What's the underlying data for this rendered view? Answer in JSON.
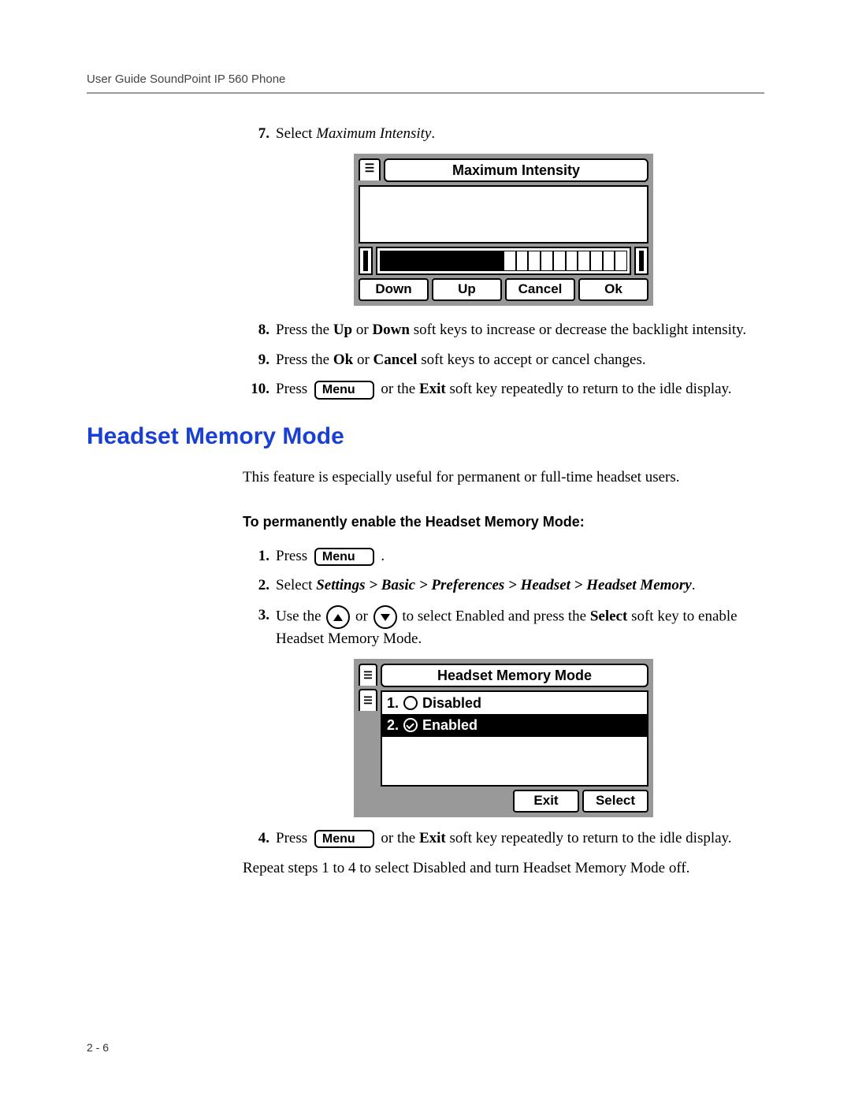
{
  "header": "User Guide SoundPoint IP 560 Phone",
  "page_number": "2 - 6",
  "steps_a": {
    "n7": "7.",
    "s7_a": "Select ",
    "s7_b": "Maximum Intensity",
    "s7_c": ".",
    "n8": "8.",
    "s8_a": "Press the ",
    "s8_b": "Up",
    "s8_c": " or ",
    "s8_d": "Down",
    "s8_e": " soft keys to increase or decrease the backlight intensity.",
    "n9": "9.",
    "s9_a": "Press the ",
    "s9_b": "Ok",
    "s9_c": " or ",
    "s9_d": "Cancel",
    "s9_e": " soft keys to accept or cancel changes.",
    "n10": "10.",
    "s10_a": "Press ",
    "s10_b": " or the ",
    "s10_c": "Exit",
    "s10_d": " soft key repeatedly to return to the idle display."
  },
  "menu_label": "Menu",
  "lcd_max": {
    "title": "Maximum Intensity",
    "softkeys": [
      "Down",
      "Up",
      "Cancel",
      "Ok"
    ],
    "segments_filled": 10,
    "segments_total": 20
  },
  "section_title": "Headset Memory Mode",
  "section_intro": "This feature is especially useful for permanent or full-time headset users.",
  "subhead": "To permanently enable the Headset Memory Mode:",
  "steps_b": {
    "n1": "1.",
    "s1_a": "Press ",
    "s1_b": ".",
    "n2": "2.",
    "s2_a": "Select ",
    "s2_b": "Settings > Basic > Preferences > Headset > Headset Memory",
    "s2_c": ".",
    "n3": "3.",
    "s3_a": "Use the ",
    "s3_b": " or ",
    "s3_c": " to select Enabled and press the ",
    "s3_d": "Select",
    "s3_e": " soft key to enable Headset Memory Mode.",
    "n4": "4.",
    "s4_a": "Press ",
    "s4_b": " or the ",
    "s4_c": "Exit",
    "s4_d": " soft key repeatedly to return to the idle display."
  },
  "lcd_hmm": {
    "title": "Headset Memory Mode",
    "item1_prefix": "1.",
    "item1_label": "Disabled",
    "item2_prefix": "2.",
    "item2_label": "Enabled",
    "softkeys": [
      "Exit",
      "Select"
    ]
  },
  "repeat_note": "Repeat steps 1 to 4 to select Disabled and turn Headset Memory Mode off."
}
